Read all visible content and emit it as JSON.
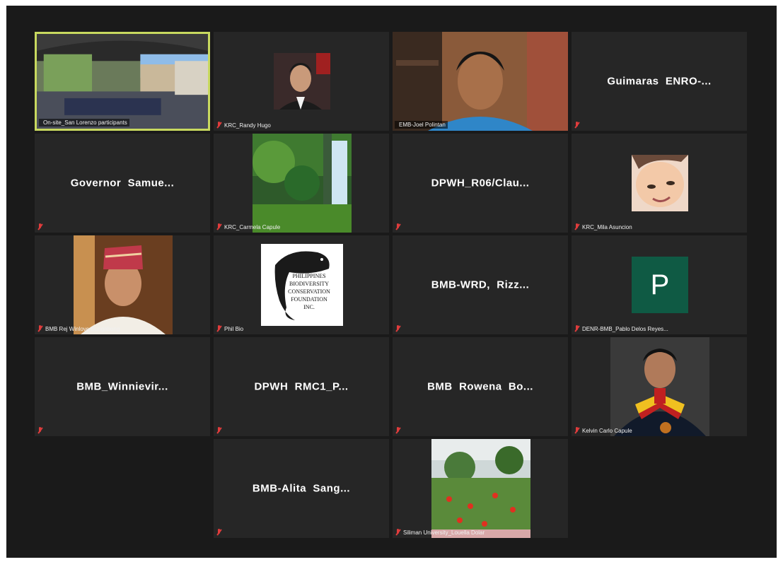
{
  "participants": [
    {
      "name": "On-site_San Lorenzo participants",
      "type": "video"
    },
    {
      "name": "KRC_Randy Hugo",
      "type": "photo"
    },
    {
      "name": "EMB-Joel Polintan",
      "type": "video"
    },
    {
      "name": "Guimaras  ENRO-...",
      "type": "text"
    },
    {
      "name": "Governor  Samue...",
      "type": "text"
    },
    {
      "name": "KRC_Carmela Capule",
      "type": "photo"
    },
    {
      "name": "DPWH_R06/Clau...",
      "type": "text"
    },
    {
      "name": "KRC_Mila Asuncion",
      "type": "photo"
    },
    {
      "name": "BMB Rej Winlove Bungabong",
      "type": "photo"
    },
    {
      "name": "Phil Bio",
      "type": "photo",
      "logo_text": [
        "PHILIPPINES",
        "BIODIVERSITY",
        "CONSERVATION",
        "FOUNDATION",
        "INC."
      ]
    },
    {
      "name": "BMB-WRD,  Rizz...",
      "type": "text"
    },
    {
      "name": "DENR-BMB_Pablo Delos Reyes...",
      "type": "avatar",
      "avatar_letter": "P",
      "avatar_color": "#0f5a44"
    },
    {
      "name": "BMB_Winnievir...",
      "type": "text"
    },
    {
      "name": "DPWH  RMC1_P...",
      "type": "text"
    },
    {
      "name": "BMB  Rowena  Bo...",
      "type": "text"
    },
    {
      "name": "Kelvin Carlo Capule",
      "type": "photo"
    },
    {
      "name": "BMB-Alita  Sang...",
      "type": "text"
    },
    {
      "name": "Siliman University_Louella Dolar",
      "type": "photo"
    }
  ],
  "colors": {
    "active_speaker_border": "#c8d95f",
    "mic_muted": "#e03c3c",
    "tile_bg": "#262626"
  }
}
